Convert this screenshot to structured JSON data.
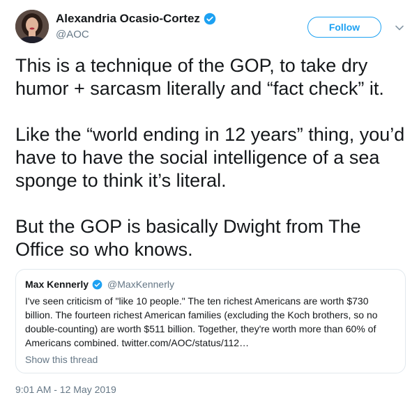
{
  "author": {
    "display_name": "Alexandria Ocasio-Cortez",
    "handle": "@AOC",
    "verified": true
  },
  "follow_button": {
    "label": "Follow"
  },
  "tweet": {
    "paragraphs": [
      "This is a technique of the GOP, to take dry humor + sarcasm literally and “fact check” it.",
      "Like the “world ending in 12 years” thing, you’d have to have the social intelligence of a sea sponge to think it’s literal.",
      "But the GOP is basically Dwight from The Office so who knows."
    ],
    "timestamp": "9:01 AM - 12 May 2019"
  },
  "quoted_tweet": {
    "display_name": "Max Kennerly",
    "handle": "@MaxKennerly",
    "verified": true,
    "text": "I've seen criticism of \"like 10 people.\" The ten richest Americans are worth $730 billion. The fourteen richest American families (excluding the Koch brothers, so no double-counting) are worth $511 billion. Together, they're worth more than 60% of Americans combined. twitter.com/AOC/status/112…",
    "show_thread_label": "Show this thread"
  },
  "colors": {
    "accent": "#1da1f2",
    "secondary_text": "#657786",
    "border": "#e1e8ed",
    "primary_text": "#14171a"
  },
  "icons": {
    "verified": "verified-badge-icon",
    "caret": "chevron-down-icon",
    "avatar": "profile-photo"
  }
}
